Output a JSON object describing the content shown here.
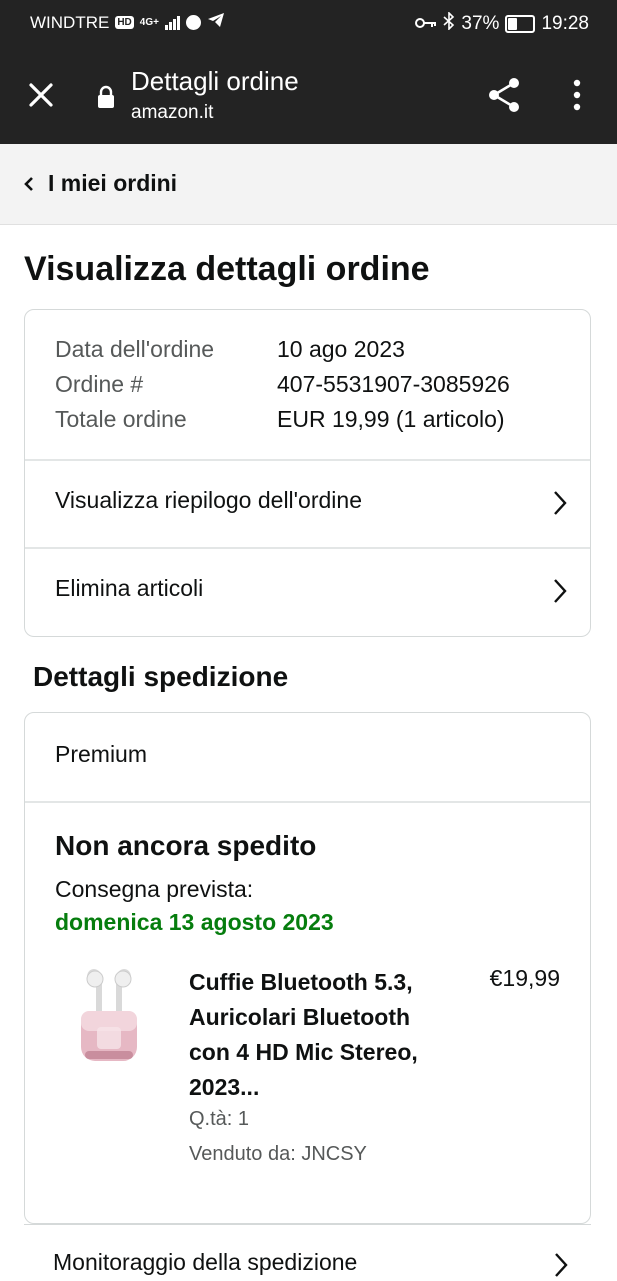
{
  "status_bar": {
    "carrier": "WINDTRE",
    "hd_badge": "HD",
    "network": "4G+",
    "battery_percent": "37%",
    "battery_level": 0.37,
    "time": "19:28"
  },
  "browser": {
    "title": "Dettagli ordine",
    "url": "amazon.it",
    "close_icon": "close-icon",
    "lock_icon": "lock-icon",
    "share_icon": "share-icon",
    "more_icon": "more-vert-icon"
  },
  "breadcrumb": {
    "label": "I miei ordini"
  },
  "page": {
    "heading": "Visualizza dettagli ordine"
  },
  "order_summary": {
    "rows": [
      {
        "label": "Data dell'ordine",
        "value": "10 ago 2023"
      },
      {
        "label": "Ordine #",
        "value": "407-5531907-3085926"
      },
      {
        "label": "Totale ordine",
        "value": "EUR 19,99 (1 articolo)"
      }
    ],
    "links": [
      {
        "label": "Visualizza riepilogo dell'ordine"
      },
      {
        "label": "Elimina articoli"
      }
    ]
  },
  "shipment": {
    "heading": "Dettagli spedizione",
    "service": "Premium",
    "status": "Non ancora spedito",
    "delivery_label": "Consegna prevista:",
    "delivery_date": "domenica 13 agosto 2023",
    "product": {
      "title": "Cuffie Bluetooth 5.3, Auricolari Bluetooth con 4 HD Mic Stereo, 2023...",
      "price": "€19,99",
      "quantity": "Q.tà: 1",
      "seller": "Venduto da: JNCSY"
    },
    "tracking_label": "Monitoraggio della spedizione"
  },
  "colors": {
    "bar_bg": "#232323",
    "delivery_green": "#067d0e",
    "muted_text": "#565959",
    "border": "#d5d9d9"
  }
}
